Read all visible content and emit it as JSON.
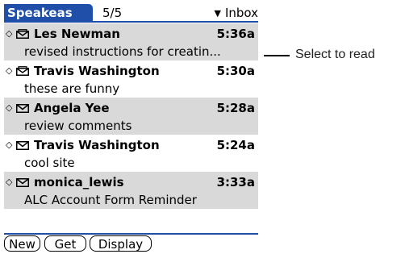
{
  "header": {
    "app_title": "Speakeas",
    "counter": "5/5",
    "category": "Inbox"
  },
  "messages": [
    {
      "status_icon": "envelope-open-icon",
      "sender": "Les Newman",
      "time": "5:36a",
      "subject": "revised instructions for creatin..."
    },
    {
      "status_icon": "envelope-open-icon",
      "sender": "Travis Washington",
      "time": "5:30a",
      "subject": "these are funny"
    },
    {
      "status_icon": "envelope-icon",
      "sender": "Angela Yee",
      "time": "5:28a",
      "subject": "review comments"
    },
    {
      "status_icon": "envelope-icon",
      "sender": "Travis Washington",
      "time": "5:24a",
      "subject": "cool site"
    },
    {
      "status_icon": "envelope-icon",
      "sender": "monica_lewis",
      "time": "3:33a",
      "subject": "ALC Account Form Reminder"
    }
  ],
  "buttons": {
    "new": "New",
    "get": "Get",
    "display": "Display"
  },
  "callout": {
    "text": "Select to read"
  },
  "colors": {
    "accent": "#1f4fa8",
    "row_shade": "#d9d9d9"
  }
}
